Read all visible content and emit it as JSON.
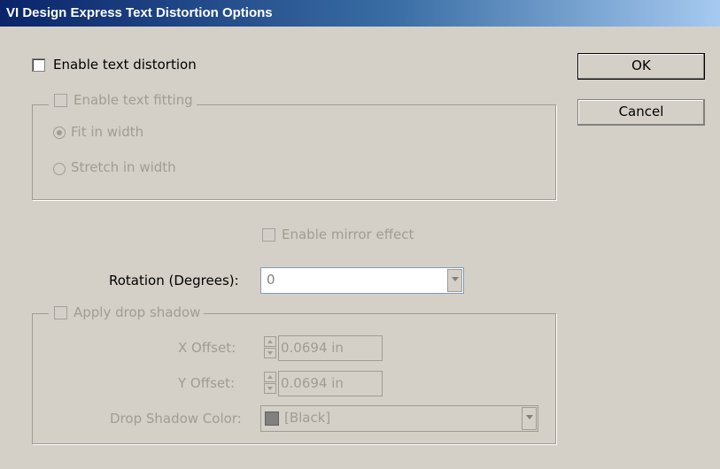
{
  "window": {
    "title": "VI Design Express Text Distortion Options"
  },
  "enable_text_distortion": {
    "label": "Enable text distortion",
    "checked": false
  },
  "text_fitting": {
    "label": "Enable text fitting",
    "checked": false,
    "fit_in_width": {
      "label": "Fit in width",
      "selected": true
    },
    "stretch_in_width": {
      "label": "Stretch in width",
      "selected": false
    }
  },
  "mirror_effect": {
    "label": "Enable mirror effect",
    "checked": false
  },
  "rotation": {
    "label": "Rotation (Degrees):",
    "value": "0"
  },
  "drop_shadow": {
    "label": "Apply drop shadow",
    "checked": false,
    "x_offset": {
      "label": "X Offset:",
      "value": "0.0694 in"
    },
    "y_offset": {
      "label": "Y Offset:",
      "value": "0.0694 in"
    },
    "color": {
      "label": "Drop Shadow Color:",
      "value": "[Black]",
      "swatch": "#808080"
    }
  },
  "buttons": {
    "ok": "OK",
    "cancel": "Cancel"
  },
  "icons": {
    "checkbox": "checkbox-icon",
    "radio": "radio-icon",
    "dropdown": "chevron-down-icon",
    "spinner": "spinner-icon"
  }
}
